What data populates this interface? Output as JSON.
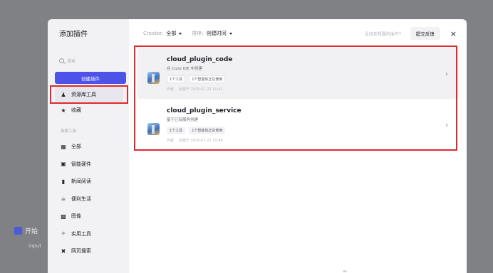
{
  "background": {
    "start_label": "开始",
    "input_label": "input"
  },
  "sidebar": {
    "title": "添加插件",
    "search_placeholder": "搜索",
    "create_button": "创建插件",
    "nav": [
      {
        "label": "资源库工具",
        "icon": "users-icon"
      },
      {
        "label": "收藏",
        "icon": "star-icon"
      }
    ],
    "group_label": "探索工具",
    "categories": [
      {
        "label": "全部",
        "icon": "grid-icon"
      },
      {
        "label": "智能硬件",
        "icon": "chip-icon"
      },
      {
        "label": "新闻阅读",
        "icon": "book-icon"
      },
      {
        "label": "便利生活",
        "icon": "coffee-icon"
      },
      {
        "label": "图像",
        "icon": "image-icon"
      },
      {
        "label": "实用工具",
        "icon": "wrench-icon"
      },
      {
        "label": "网页搜索",
        "icon": "cross-icon"
      }
    ]
  },
  "topbar": {
    "creator_label": "Creator:",
    "creator_value": "全部",
    "sort_label": "排序:",
    "sort_value": "创建时间",
    "help_link": "没找到想要的插件？",
    "feedback_button": "提交反馈",
    "close_symbol": "×"
  },
  "plugins": [
    {
      "name": "cloud_plugin_code",
      "description": "在 Coze IDE 中创建",
      "tags": [
        "1个工具",
        "1个智能体正在使用"
      ],
      "meta": [
        "作者",
        "创建于 2025-07-22 10:41"
      ]
    },
    {
      "name": "cloud_plugin_service",
      "description": "基于已有服务创建",
      "tags": [
        "1个工具",
        "1个智能体正在使用"
      ],
      "meta": [
        "作者",
        "创建于 2025-07-22 10:40"
      ]
    }
  ],
  "colors": {
    "accent": "#4d53e8",
    "highlight": "#e0282e"
  }
}
